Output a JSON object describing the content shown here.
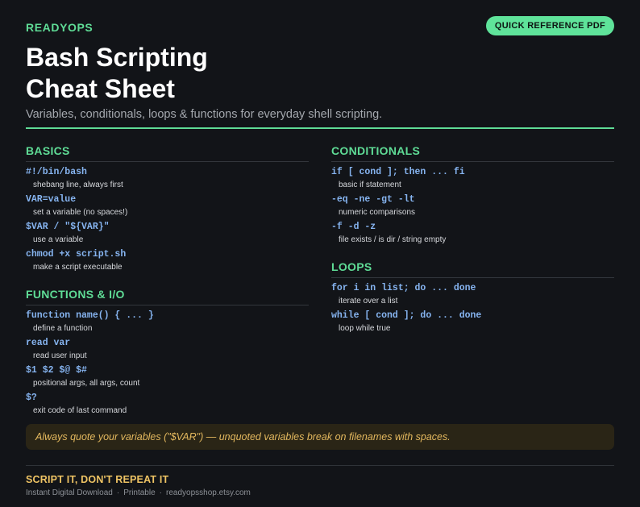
{
  "header": {
    "brand": "READYOPS",
    "pdf_button": "QUICK REFERENCE PDF",
    "title_line1": "Bash Scripting",
    "title_line2": "Cheat Sheet",
    "subtitle": "Variables, conditionals, loops & functions for everyday shell scripting."
  },
  "colors": {
    "accent_green": "#5fdc96",
    "code_blue": "#86b4f0",
    "tip_gold": "#e3b85e",
    "background": "#121418"
  },
  "sections": {
    "basics": {
      "heading": "BASICS",
      "entries": [
        {
          "code": "#!/bin/bash",
          "desc": "shebang line, always first"
        },
        {
          "code": "VAR=value",
          "desc": "set a variable (no spaces!)"
        },
        {
          "code": "$VAR / \"${VAR}\"",
          "desc": "use a variable"
        },
        {
          "code": "chmod +x script.sh",
          "desc": "make a script executable"
        }
      ]
    },
    "functions": {
      "heading": "FUNCTIONS & I/O",
      "entries": [
        {
          "code": "function name() { ... }",
          "desc": "define a function"
        },
        {
          "code": "read var",
          "desc": "read user input"
        },
        {
          "code": "$1 $2 $@ $#",
          "desc": "positional args, all args, count"
        },
        {
          "code": "$?",
          "desc": "exit code of last command"
        }
      ]
    },
    "conditionals": {
      "heading": "CONDITIONALS",
      "entries": [
        {
          "code": "if [ cond ]; then ... fi",
          "desc": "basic if statement"
        },
        {
          "code": "-eq -ne -gt -lt",
          "desc": "numeric comparisons"
        },
        {
          "code": "-f -d -z",
          "desc": "file exists / is dir / string empty"
        }
      ]
    },
    "loops": {
      "heading": "LOOPS",
      "entries": [
        {
          "code": "for i in list; do ... done",
          "desc": "iterate over a list"
        },
        {
          "code": "while [ cond ]; do ... done",
          "desc": "loop while true"
        }
      ]
    }
  },
  "tip": "Always quote your variables (\"$VAR\") — unquoted variables break on filenames with spaces.",
  "footer": {
    "tagline": "SCRIPT IT, DON'T REPEAT IT",
    "items": [
      "Instant Digital Download",
      "Printable",
      "readyopsshop.etsy.com"
    ],
    "separator": "·"
  }
}
